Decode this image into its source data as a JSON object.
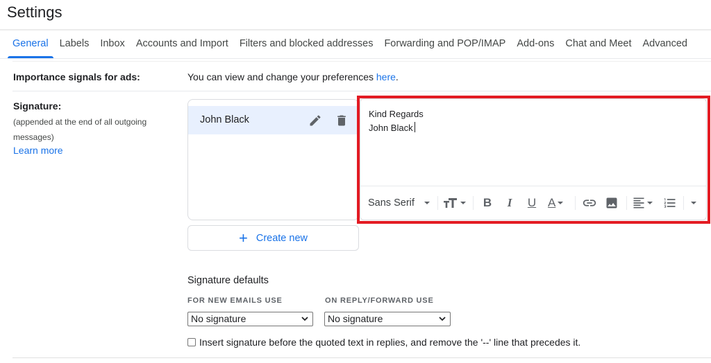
{
  "header": {
    "title": "Settings"
  },
  "tabs": [
    {
      "label": "General",
      "active": true
    },
    {
      "label": "Labels",
      "active": false
    },
    {
      "label": "Inbox",
      "active": false
    },
    {
      "label": "Accounts and Import",
      "active": false
    },
    {
      "label": "Filters and blocked addresses",
      "active": false
    },
    {
      "label": "Forwarding and POP/IMAP",
      "active": false
    },
    {
      "label": "Add-ons",
      "active": false
    },
    {
      "label": "Chat and Meet",
      "active": false
    },
    {
      "label": "Advanced",
      "active": false
    }
  ],
  "importance": {
    "label": "Importance signals for ads:",
    "text": "You can view and change your preferences ",
    "link": "here",
    "trailing": "."
  },
  "signature": {
    "label": "Signature:",
    "sublabel": "(appended at the end of all outgoing messages)",
    "learn_more": "Learn more",
    "list": [
      {
        "name": "John Black",
        "selected": true
      }
    ],
    "item_icons": [
      "edit-icon",
      "delete-icon"
    ],
    "create_new": "Create new",
    "editor": {
      "lines": [
        "Kind Regards",
        "John Black"
      ]
    },
    "toolbar": {
      "font": "Sans Serif",
      "buttons": [
        "font-size",
        "bold",
        "italic",
        "underline",
        "text-color",
        "link",
        "insert-image",
        "align",
        "numbered-list",
        "more-formatting"
      ]
    }
  },
  "defaults": {
    "title": "Signature defaults",
    "new_emails_label": "FOR NEW EMAILS USE",
    "new_emails_value": "No signature",
    "reply_label": "ON REPLY/FORWARD USE",
    "reply_value": "No signature",
    "checkbox_label": "Insert signature before the quoted text in replies, and remove the '--' line that precedes it.",
    "checkbox_checked": false
  },
  "colors": {
    "accent": "#1a73e8",
    "highlight_frame": "#e31b23",
    "selected_item_bg": "#e8f0fe"
  }
}
